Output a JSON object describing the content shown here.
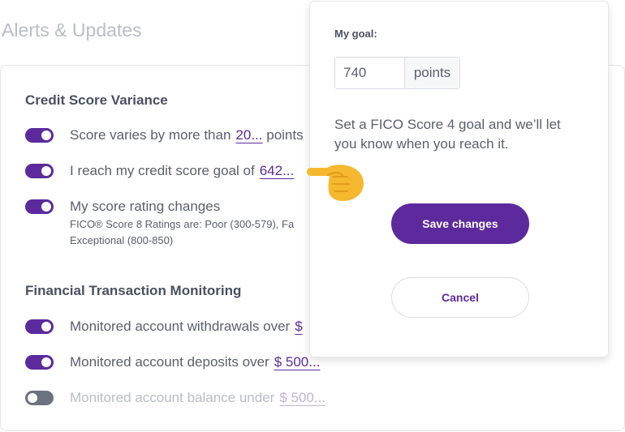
{
  "page": {
    "title": "Alerts & Updates"
  },
  "credit_section": {
    "title": "Credit Score Variance",
    "rows": [
      {
        "label": "Score varies by more than",
        "value": "20...",
        "suffix": "points",
        "enabled": true
      },
      {
        "label": "I reach my credit score goal of",
        "value": "642...",
        "enabled": true
      },
      {
        "label": "My score rating changes",
        "enabled": true,
        "note_line1": "FICO® Score 8 Ratings are:  Poor (300-579), Fa",
        "note_line2": "Exceptional (800-850)"
      }
    ]
  },
  "transaction_section": {
    "title": "Financial Transaction Monitoring",
    "rows": [
      {
        "label": "Monitored account withdrawals over",
        "value": "$",
        "enabled": true
      },
      {
        "label": "Monitored account deposits over",
        "value": "$ 500...",
        "enabled": true
      },
      {
        "label": "Monitored account balance under",
        "value": "$ 500...",
        "enabled": false
      }
    ]
  },
  "goal_popover": {
    "label": "My goal:",
    "value": "740",
    "unit": "points",
    "description": "Set a FICO Score 4 goal and we’ll let you know when you reach it.",
    "save_label": "Save changes",
    "cancel_label": "Cancel"
  },
  "colors": {
    "accent": "#5c2a9d",
    "toggle_off": "#6b7280",
    "pointer": "#f5b82e"
  },
  "icons": {
    "pointer": "pointing-hand-icon"
  }
}
